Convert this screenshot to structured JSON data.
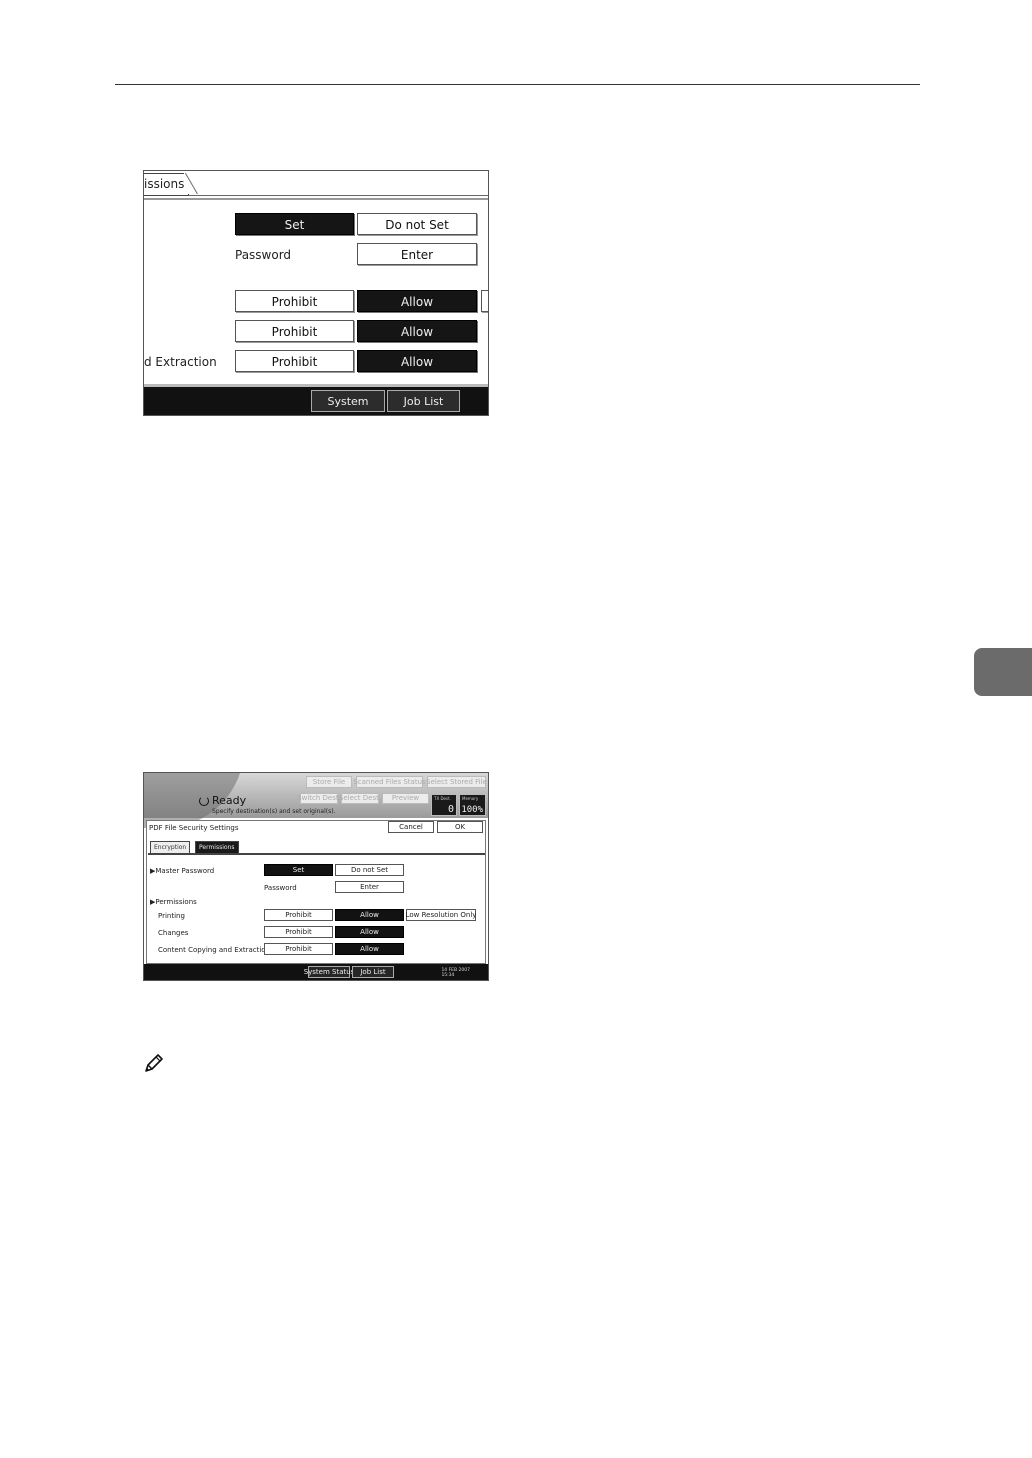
{
  "shot1": {
    "tab_label": "issions",
    "master_set": "Set",
    "master_do_not_set": "Do not Set",
    "password_label": "Password",
    "enter": "Enter",
    "printing_prohibit": "Prohibit",
    "printing_allow": "Allow",
    "changes_prohibit": "Prohibit",
    "changes_allow": "Allow",
    "extraction_label": "d Extraction",
    "extraction_prohibit": "Prohibit",
    "extraction_allow": "Allow",
    "system_status": "System Status",
    "job_list": "Job List"
  },
  "shot2": {
    "ghost_buttons": [
      "Store File",
      "Scanned Files Status",
      "Select Stored File",
      "Switch Dest.",
      "Select Dest.",
      "Preview"
    ],
    "ready": "Ready",
    "subtitle": "Specify destination(s) and set original(s).",
    "tx_dest_label": "TX Dest.",
    "tx_dest_value": "0",
    "memory_label": "Memory",
    "memory_value": "100%",
    "panel_title": "PDF File Security Settings",
    "cancel": "Cancel",
    "ok": "OK",
    "tab_encryption": "Encryption",
    "tab_permissions": "Permissions",
    "master_password": "▶Master Password",
    "set": "Set",
    "do_not_set": "Do not Set",
    "password_label": "Password",
    "enter": "Enter",
    "permissions_header": "▶Permissions",
    "printing_label": "Printing",
    "changes_label": "Changes",
    "copying_label": "Content Copying and Extraction",
    "prohibit": "Prohibit",
    "allow": "Allow",
    "low_resolution_only": "Low Resolution Only",
    "system_status": "System Status",
    "job_list": "Job List",
    "date": "14 FEB  2007",
    "time": "15:34"
  }
}
